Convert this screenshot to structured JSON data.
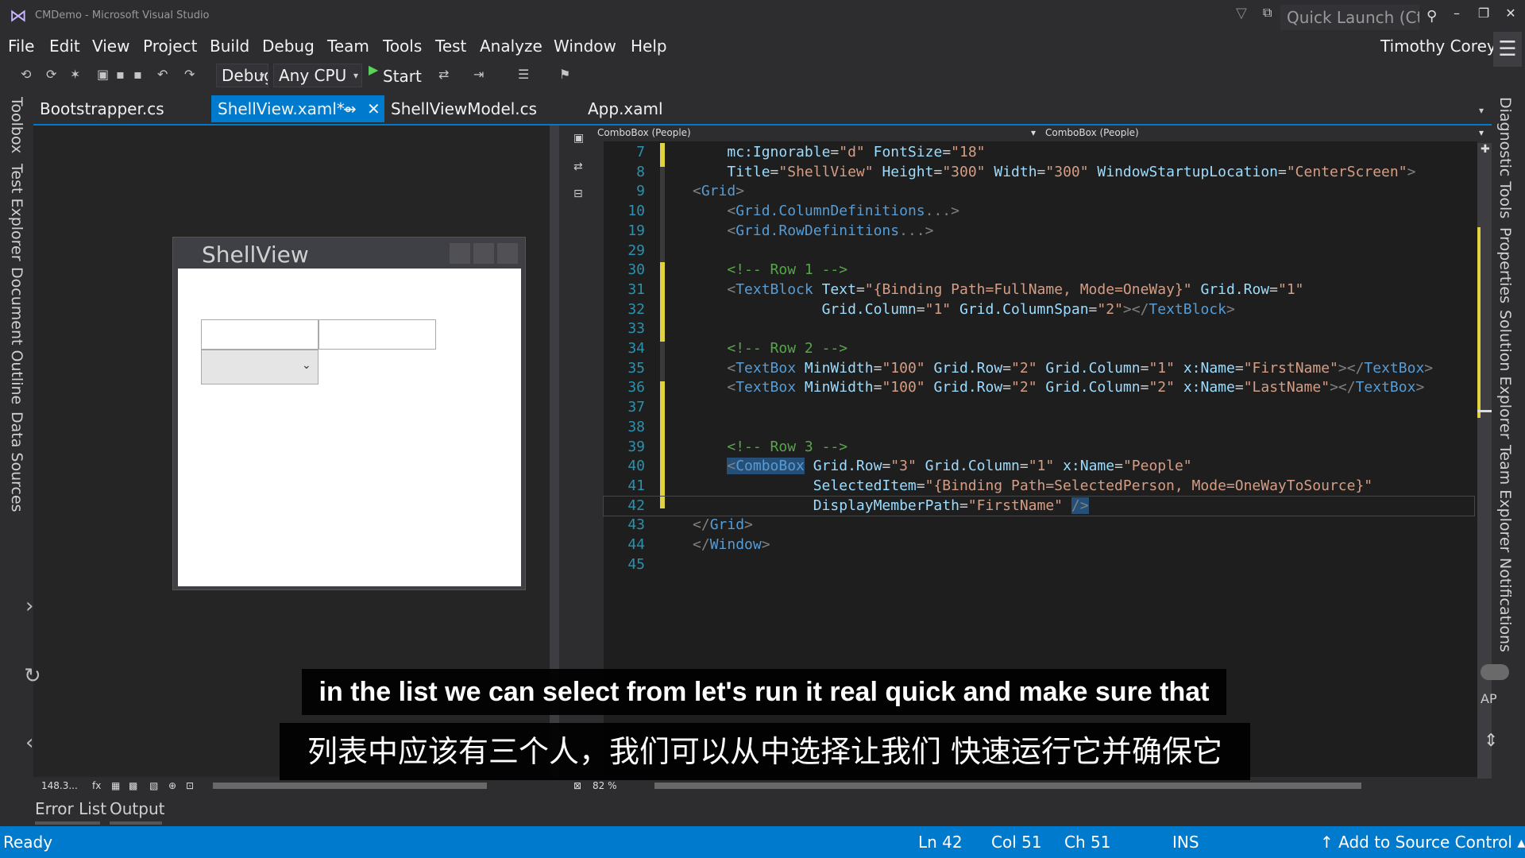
{
  "window": {
    "title": "CMDemo - Microsoft Visual Studio",
    "quick_launch_placeholder": "Quick Launch (Ctrl+Q)",
    "user": "Timothy Corey"
  },
  "menu": [
    "File",
    "Edit",
    "View",
    "Project",
    "Build",
    "Debug",
    "Team",
    "Tools",
    "Test",
    "Analyze",
    "Window",
    "Help"
  ],
  "toolbar": {
    "config": "Debug",
    "platform": "Any CPU",
    "start_label": "Start"
  },
  "left_tools": [
    "Toolbox",
    "Test Explorer",
    "Document Outline",
    "Data Sources"
  ],
  "right_tools": [
    "Diagnostic Tools",
    "Properties",
    "Solution Explorer",
    "Team Explorer",
    "Notifications"
  ],
  "doc_tabs": [
    "Bootstrapper.cs",
    "ShellView.xaml*",
    "ShellViewModel.cs",
    "App.xaml"
  ],
  "designer": {
    "window_title": "ShellView",
    "zoom": "148.3...",
    "fx": "fx"
  },
  "nav": {
    "left": "ComboBox (People)",
    "right": "ComboBox (People)"
  },
  "editor_zoom": "82 %",
  "code": {
    "l7": "7",
    "l8": "8",
    "l9": "9",
    "l10": "10",
    "l19": "19",
    "l29": "29",
    "l30": "30",
    "l31": "31",
    "l32": "32",
    "l33": "33",
    "l34": "34",
    "l35": "35",
    "l36": "36",
    "l37": "37",
    "l38": "38",
    "l39": "39",
    "l40": "40",
    "l41": "41",
    "l42": "42",
    "l43": "43",
    "l44": "44",
    "l45": "45"
  },
  "bottom_tabs": [
    "Error List",
    "Output"
  ],
  "status": {
    "ready": "Ready",
    "ln": "Ln 42",
    "col": "Col 51",
    "ch": "Ch 51",
    "ins": "INS",
    "source_control": "↑ Add to Source Control ▴"
  },
  "side": {
    "ap": "AP"
  },
  "subtitles": {
    "en": "in the list we can select from let's run it real quick and make sure that",
    "zh": "列表中应该有三个人，我们可以从中选择让我们 快速运行它并确保它"
  }
}
